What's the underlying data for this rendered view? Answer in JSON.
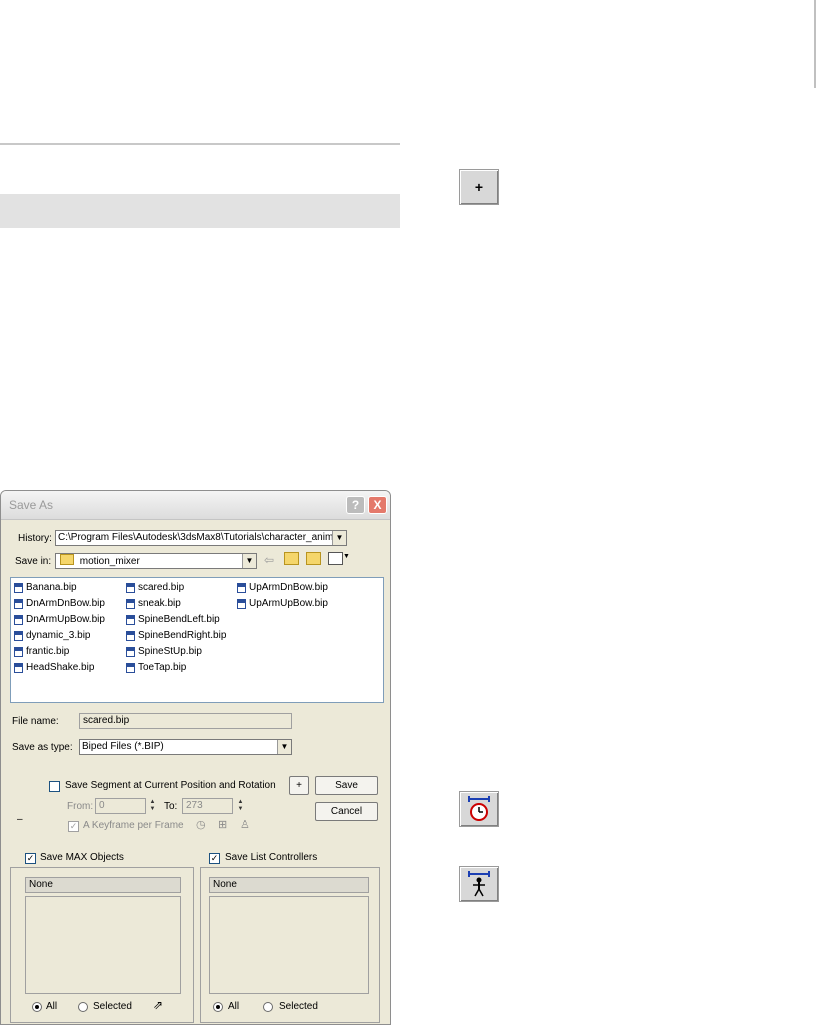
{
  "page": {
    "tool_buttons": {
      "plus": "+"
    }
  },
  "dialog": {
    "title": "Save As",
    "help_btn": "?",
    "close_btn": "X",
    "history_label": "History:",
    "history_value": "C:\\Program Files\\Autodesk\\3dsMax8\\Tutorials\\character_anim",
    "save_in_label": "Save in:",
    "save_in_value": "motion_mixer",
    "files": [
      [
        "Banana.bip",
        "DnArmDnBow.bip",
        "DnArmUpBow.bip",
        "dynamic_3.bip",
        "frantic.bip",
        "HeadShake.bip"
      ],
      [
        "scared.bip",
        "sneak.bip",
        "SpineBendLeft.bip",
        "SpineBendRight.bip",
        "SpineStUp.bip",
        "ToeTap.bip"
      ],
      [
        "UpArmDnBow.bip",
        "UpArmUpBow.bip"
      ]
    ],
    "file_name_label": "File name:",
    "file_name_value": "scared.bip",
    "save_as_type_label": "Save as type:",
    "save_as_type_value": "Biped Files (*.BIP)",
    "save_segment_label": "Save Segment at Current Position and Rotation",
    "plus_btn": "+",
    "save_btn": "Save",
    "cancel_btn": "Cancel",
    "from_label": "From:",
    "from_value": "0",
    "to_label": "To:",
    "to_value": "273",
    "keyframe_label": "A Keyframe per Frame",
    "dash": "–",
    "save_max_objects_label": "Save MAX Objects",
    "save_list_controllers_label": "Save List Controllers",
    "left_list_header": "None",
    "right_list_header": "None",
    "radio_all": "All",
    "radio_selected": "Selected"
  }
}
